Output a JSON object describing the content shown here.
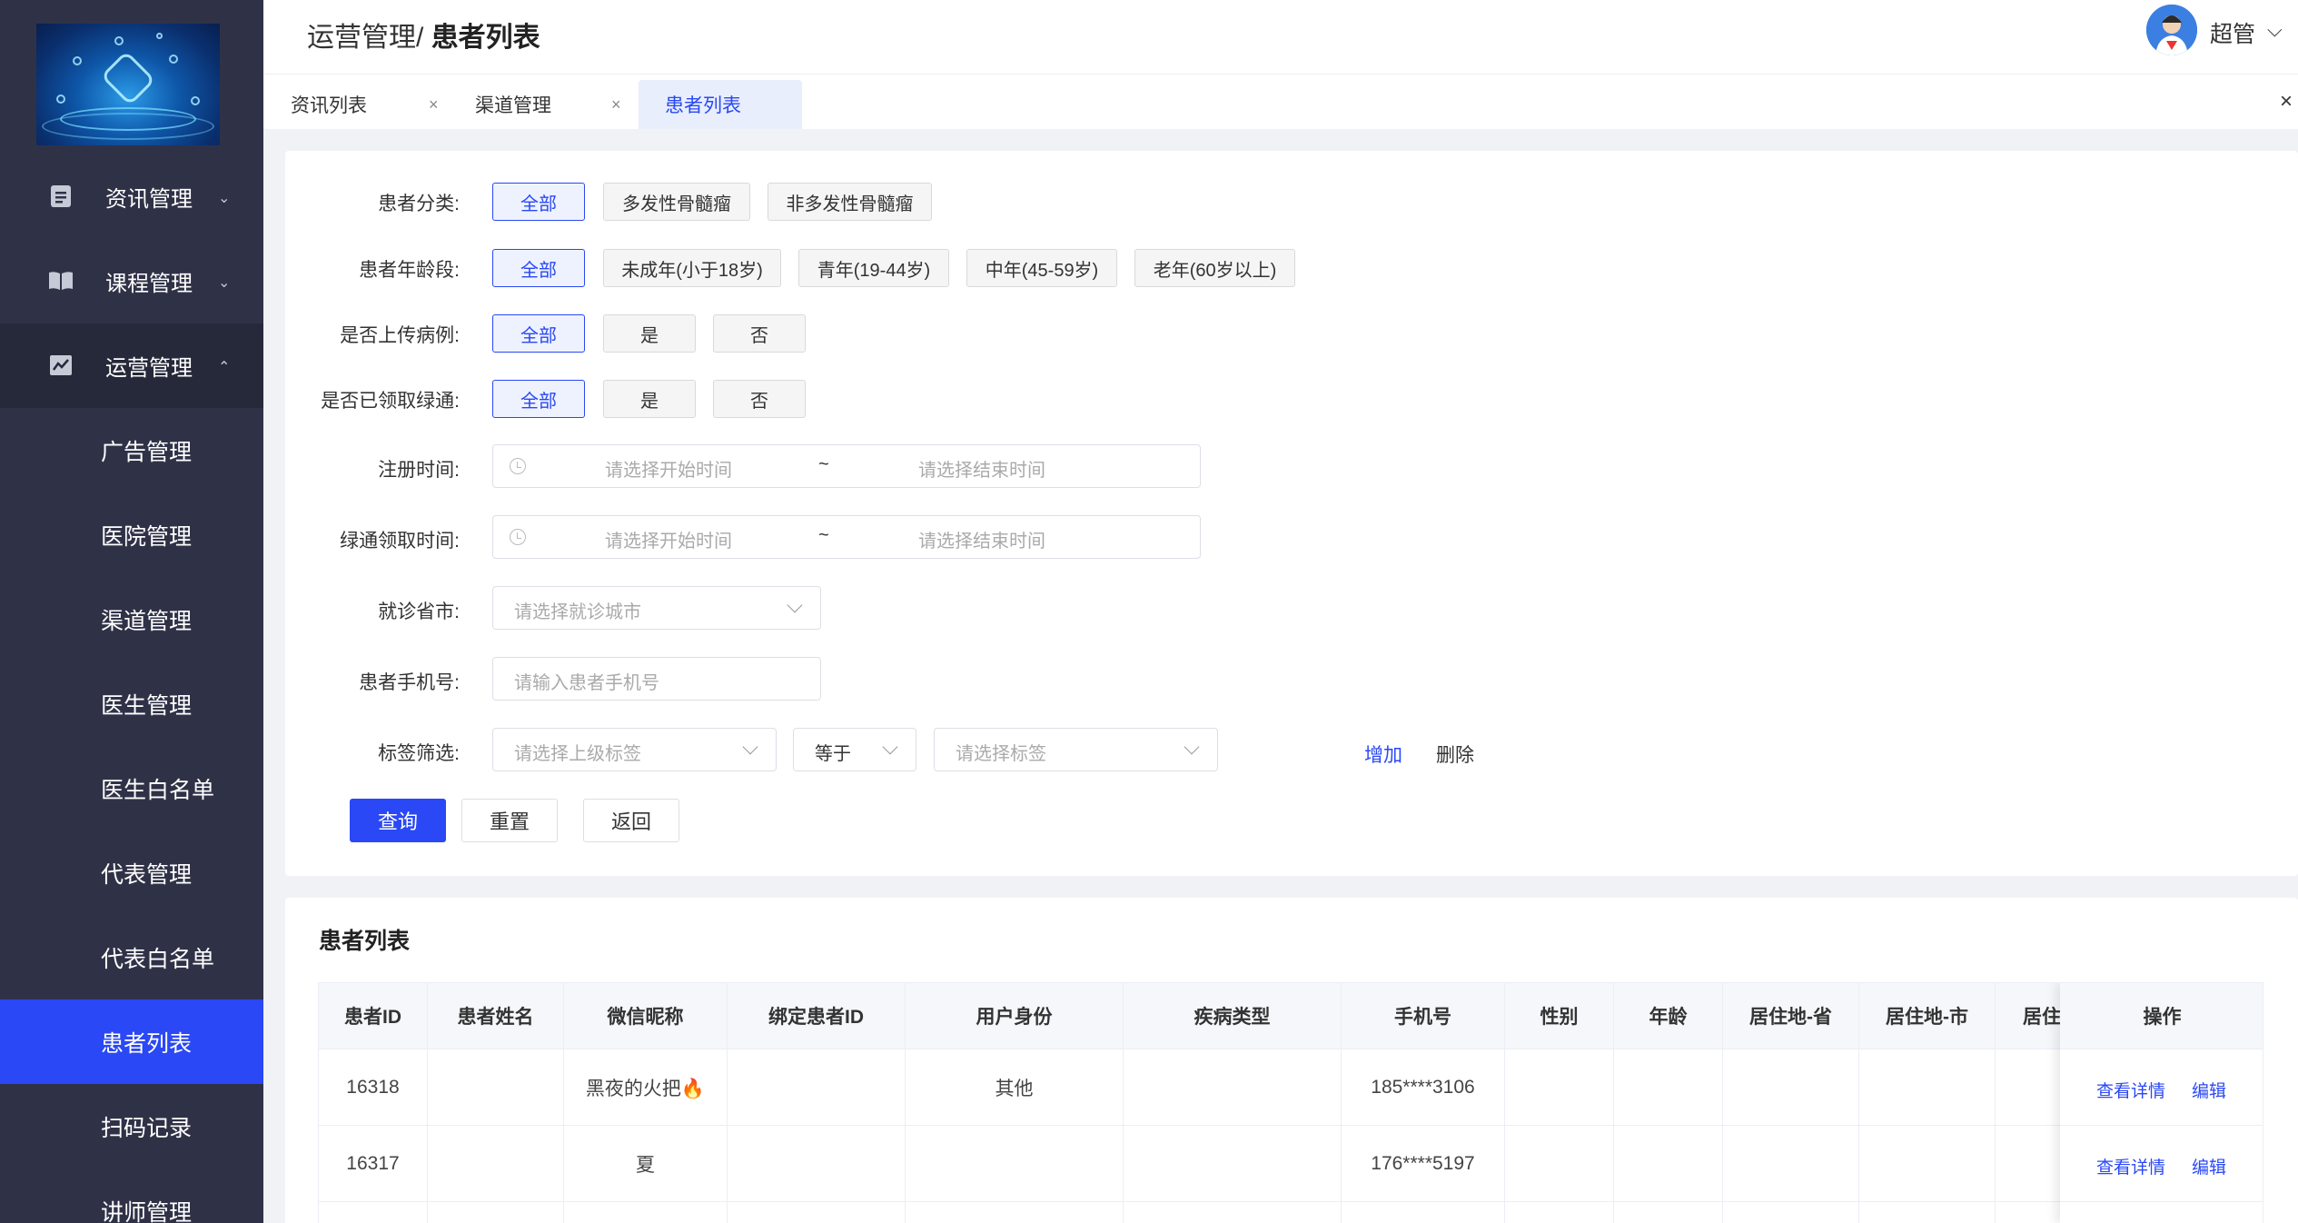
{
  "sidebar": {
    "menus": [
      {
        "label": "资讯管理",
        "icon": "document-icon",
        "arrow": "⌄"
      },
      {
        "label": "课程管理",
        "icon": "book-icon",
        "arrow": "⌄"
      },
      {
        "label": "运营管理",
        "icon": "chart-icon",
        "arrow": "⌃"
      }
    ],
    "submenu": [
      "广告管理",
      "医院管理",
      "渠道管理",
      "医生管理",
      "医生白名单",
      "代表管理",
      "代表白名单",
      "患者列表",
      "扫码记录",
      "讲师管理"
    ],
    "active_submenu": "患者列表"
  },
  "header": {
    "breadcrumb_parent": "运营管理/",
    "breadcrumb_current": "患者列表",
    "user_name": "超管",
    "caret": "⌵"
  },
  "tabs": [
    {
      "label": "资讯列表",
      "close": "×"
    },
    {
      "label": "渠道管理",
      "close": "×"
    },
    {
      "label": "患者列表"
    }
  ],
  "tabs_close_all": "×",
  "filters": {
    "category": {
      "label": "患者分类:",
      "options": [
        "全部",
        "多发性骨髓瘤",
        "非多发性骨髓瘤"
      ],
      "selected": "全部"
    },
    "age": {
      "label": "患者年龄段:",
      "options": [
        "全部",
        "未成年(小于18岁)",
        "青年(19-44岁)",
        "中年(45-59岁)",
        "老年(60岁以上)"
      ],
      "selected": "全部"
    },
    "case_upload": {
      "label": "是否上传病例:",
      "options": [
        "全部",
        "是",
        "否"
      ],
      "selected": "全部"
    },
    "green_channel": {
      "label": "是否已领取绿通:",
      "options": [
        "全部",
        "是",
        "否"
      ],
      "selected": "全部"
    },
    "register_time": {
      "label": "注册时间:",
      "start_placeholder": "请选择开始时间",
      "separator": "~",
      "end_placeholder": "请选择结束时间"
    },
    "green_time": {
      "label": "绿通领取时间:",
      "start_placeholder": "请选择开始时间",
      "separator": "~",
      "end_placeholder": "请选择结束时间"
    },
    "city": {
      "label": "就诊省市:",
      "placeholder": "请选择就诊城市"
    },
    "phone": {
      "label": "患者手机号:",
      "placeholder": "请输入患者手机号"
    },
    "tag": {
      "label": "标签筛选:",
      "parent_placeholder": "请选择上级标签",
      "operator": "等于",
      "tag_placeholder": "请选择标签",
      "add": "增加",
      "delete": "删除"
    },
    "buttons": {
      "query": "查询",
      "reset": "重置",
      "back": "返回"
    }
  },
  "list": {
    "title": "患者列表",
    "columns": [
      "患者ID",
      "患者姓名",
      "微信昵称",
      "绑定患者ID",
      "用户身份",
      "疾病类型",
      "手机号",
      "性别",
      "年龄",
      "居住地-省",
      "居住地-市",
      "居住"
    ],
    "ops_header": "操作",
    "rows": [
      {
        "id": "16318",
        "name": "",
        "nickname": "黑夜的火把🔥",
        "bound_id": "",
        "identity": "其他",
        "disease": "",
        "phone": "185****3106",
        "gender": "",
        "age": "",
        "province": "",
        "city": "",
        "addr": ""
      },
      {
        "id": "16317",
        "name": "",
        "nickname": "夏",
        "bound_id": "",
        "identity": "",
        "disease": "",
        "phone": "176****5197",
        "gender": "",
        "age": "",
        "province": "",
        "city": "",
        "addr": ""
      }
    ],
    "row_actions": {
      "view": "查看详情",
      "edit": "编辑"
    }
  },
  "colors": {
    "sidebar_bg": "#2f3247",
    "accent": "#2a48f5",
    "active_menu_bg": "#262939"
  }
}
